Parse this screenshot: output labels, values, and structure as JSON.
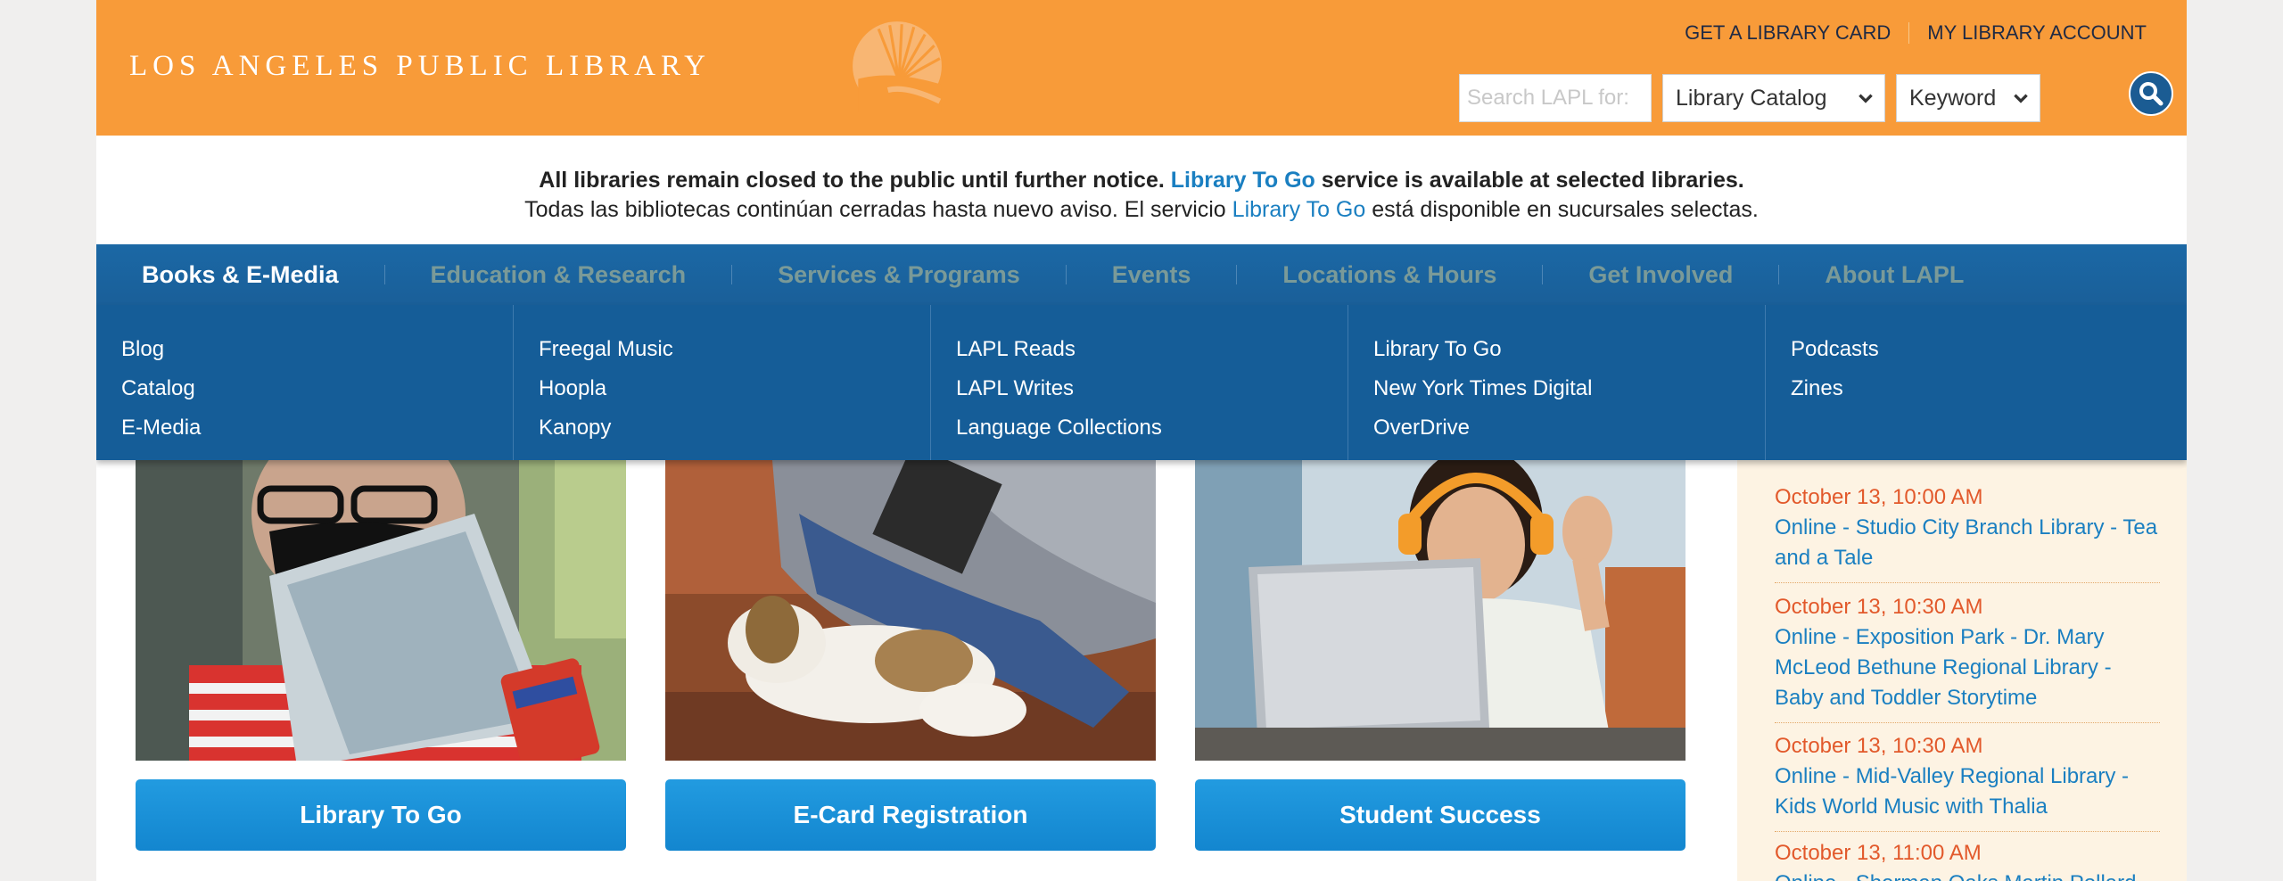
{
  "header": {
    "logo_text": "LOS ANGELES PUBLIC LIBRARY",
    "links": {
      "card": "GET A LIBRARY CARD",
      "account": "MY LIBRARY ACCOUNT"
    },
    "search": {
      "placeholder": "Search LAPL for:",
      "scope": "Library Catalog",
      "type": "Keyword"
    }
  },
  "notice": {
    "en_before": "All libraries remain closed to the public until further notice.",
    "en_link": "Library To Go",
    "en_after": "service is available at selected libraries.",
    "es_before": "Todas las bibliotecas continúan cerradas hasta nuevo aviso. El servicio",
    "es_link": "Library To Go",
    "es_after": "está disponible en sucursales selectas."
  },
  "nav": {
    "items": [
      "Books & E-Media",
      "Education & Research",
      "Services & Programs",
      "Events",
      "Locations & Hours",
      "Get Involved",
      "About LAPL"
    ]
  },
  "dropdown": {
    "columns": [
      [
        "Blog",
        "Catalog",
        "E-Media"
      ],
      [
        "Freegal Music",
        "Hoopla",
        "Kanopy"
      ],
      [
        "LAPL Reads",
        "LAPL Writes",
        "Language Collections"
      ],
      [
        "Library To Go",
        "New York Times Digital",
        "OverDrive"
      ],
      [
        "Podcasts",
        "Zines"
      ]
    ]
  },
  "tiles": [
    {
      "label": "Library To Go"
    },
    {
      "label": "E-Card Registration"
    },
    {
      "label": "Student Success"
    }
  ],
  "events": [
    {
      "date": "October 13, 10:00 AM",
      "title": "Online - Studio City Branch Library - Tea and a Tale"
    },
    {
      "date": "October 13, 10:30 AM",
      "title": "Online - Exposition Park - Dr. Mary McLeod Bethune Regional Library - Baby and Toddler Storytime"
    },
    {
      "date": "October 13, 10:30 AM",
      "title": "Online - Mid-Valley Regional Library - Kids World Music with Thalia"
    },
    {
      "date": "October 13, 11:00 AM",
      "title": "Online - Sherman Oaks Martin Pollard"
    }
  ],
  "colors": {
    "header_orange": "#f89b39",
    "nav_blue": "#1a5f99",
    "link_blue": "#1a7fc1",
    "event_date": "#e2592b"
  }
}
